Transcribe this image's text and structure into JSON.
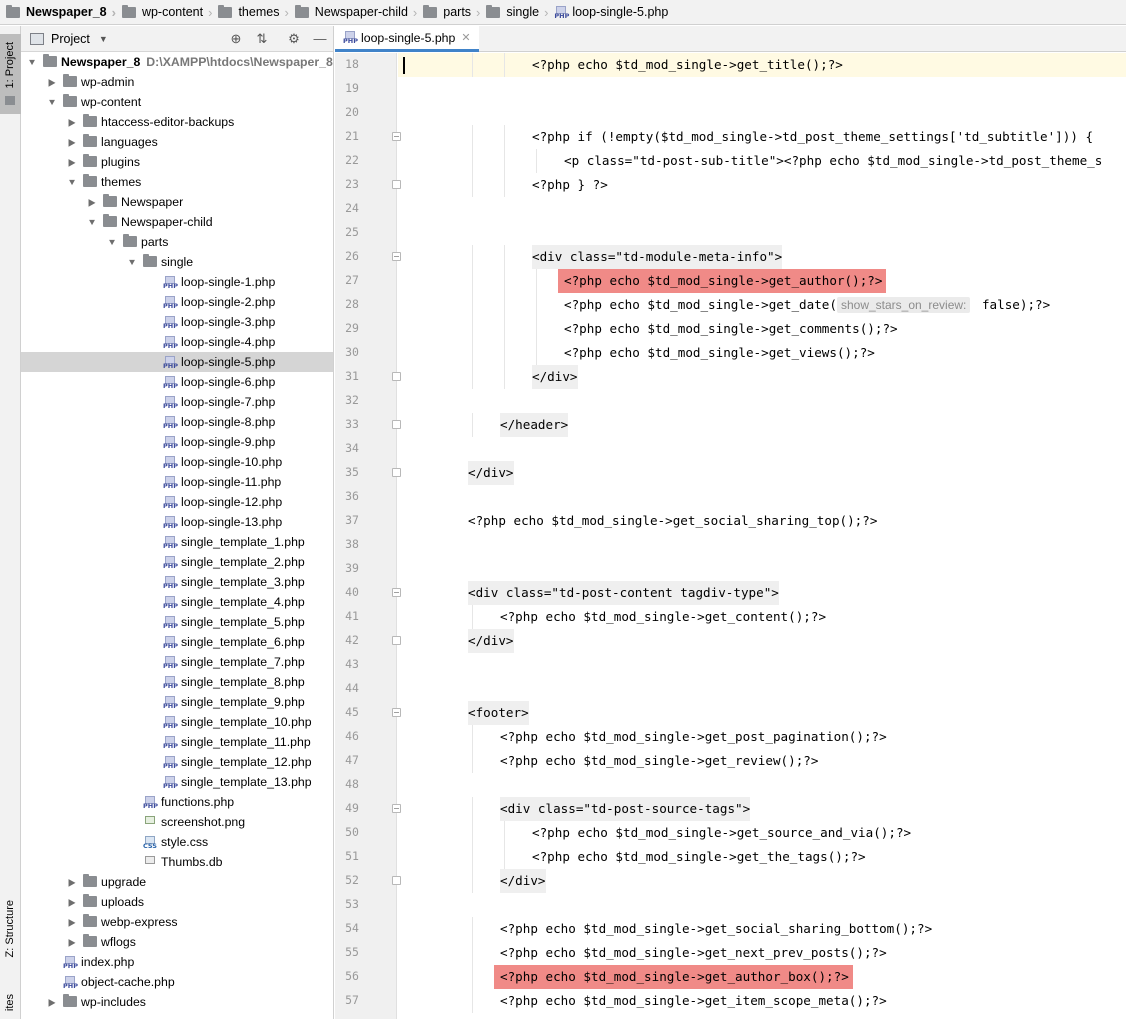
{
  "breadcrumb": [
    {
      "label": "Newspaper_8",
      "icon": "folder-icon"
    },
    {
      "label": "wp-content",
      "icon": "folder-icon"
    },
    {
      "label": "themes",
      "icon": "folder-icon"
    },
    {
      "label": "Newspaper-child",
      "icon": "folder-icon"
    },
    {
      "label": "parts",
      "icon": "folder-icon"
    },
    {
      "label": "single",
      "icon": "folder-icon"
    },
    {
      "label": "loop-single-5.php",
      "icon": "php-file-icon"
    }
  ],
  "left_strip": {
    "project_tab": "1: Project",
    "structure_tab": "Z: Structure",
    "favorites_tab": "ites"
  },
  "project_panel": {
    "title": "Project",
    "tree": [
      {
        "label": "Newspaper_8",
        "hint": "D:\\XAMPP\\htdocs\\Newspaper_8",
        "type": "folder",
        "expanded": true,
        "bold": true
      },
      {
        "label": "wp-admin",
        "type": "folder",
        "expanded": false
      },
      {
        "label": "wp-content",
        "type": "folder",
        "expanded": true
      },
      {
        "label": "htaccess-editor-backups",
        "type": "folder",
        "expanded": false
      },
      {
        "label": "languages",
        "type": "folder",
        "expanded": false
      },
      {
        "label": "plugins",
        "type": "folder",
        "expanded": false
      },
      {
        "label": "themes",
        "type": "folder",
        "expanded": true
      },
      {
        "label": "Newspaper",
        "type": "folder",
        "expanded": false
      },
      {
        "label": "Newspaper-child",
        "type": "folder",
        "expanded": true
      },
      {
        "label": "parts",
        "type": "folder",
        "expanded": true
      },
      {
        "label": "single",
        "type": "folder",
        "expanded": true
      },
      {
        "label": "loop-single-1.php",
        "type": "php"
      },
      {
        "label": "loop-single-2.php",
        "type": "php"
      },
      {
        "label": "loop-single-3.php",
        "type": "php"
      },
      {
        "label": "loop-single-4.php",
        "type": "php"
      },
      {
        "label": "loop-single-5.php",
        "type": "php",
        "selected": true
      },
      {
        "label": "loop-single-6.php",
        "type": "php"
      },
      {
        "label": "loop-single-7.php",
        "type": "php"
      },
      {
        "label": "loop-single-8.php",
        "type": "php"
      },
      {
        "label": "loop-single-9.php",
        "type": "php"
      },
      {
        "label": "loop-single-10.php",
        "type": "php"
      },
      {
        "label": "loop-single-11.php",
        "type": "php"
      },
      {
        "label": "loop-single-12.php",
        "type": "php"
      },
      {
        "label": "loop-single-13.php",
        "type": "php"
      },
      {
        "label": "single_template_1.php",
        "type": "php"
      },
      {
        "label": "single_template_2.php",
        "type": "php"
      },
      {
        "label": "single_template_3.php",
        "type": "php"
      },
      {
        "label": "single_template_4.php",
        "type": "php"
      },
      {
        "label": "single_template_5.php",
        "type": "php"
      },
      {
        "label": "single_template_6.php",
        "type": "php"
      },
      {
        "label": "single_template_7.php",
        "type": "php"
      },
      {
        "label": "single_template_8.php",
        "type": "php"
      },
      {
        "label": "single_template_9.php",
        "type": "php"
      },
      {
        "label": "single_template_10.php",
        "type": "php"
      },
      {
        "label": "single_template_11.php",
        "type": "php"
      },
      {
        "label": "single_template_12.php",
        "type": "php"
      },
      {
        "label": "single_template_13.php",
        "type": "php"
      },
      {
        "label": "functions.php",
        "type": "php"
      },
      {
        "label": "screenshot.png",
        "type": "png"
      },
      {
        "label": "style.css",
        "type": "css"
      },
      {
        "label": "Thumbs.db",
        "type": "db"
      },
      {
        "label": "upgrade",
        "type": "folder",
        "expanded": false
      },
      {
        "label": "uploads",
        "type": "folder",
        "expanded": false
      },
      {
        "label": "webp-express",
        "type": "folder",
        "expanded": false
      },
      {
        "label": "wflogs",
        "type": "folder",
        "expanded": false
      },
      {
        "label": "index.php",
        "type": "php"
      },
      {
        "label": "object-cache.php",
        "type": "php"
      },
      {
        "label": "wp-includes",
        "type": "folder",
        "expanded": false
      }
    ]
  },
  "editor": {
    "tab_label": "loop-single-5.php",
    "current_line": 18,
    "lines": [
      {
        "no": 18,
        "text": "<?php echo $td_mod_single->get_title();?>"
      },
      {
        "no": 19,
        "text": ""
      },
      {
        "no": 20,
        "text": ""
      },
      {
        "no": 21,
        "text": "<?php if (!empty($td_mod_single->td_post_theme_settings['td_subtitle'])) {"
      },
      {
        "no": 22,
        "text": "<p class=\"td-post-sub-title\"><?php echo $td_mod_single->td_post_theme_s"
      },
      {
        "no": 23,
        "text": "<?php } ?>"
      },
      {
        "no": 24,
        "text": ""
      },
      {
        "no": 25,
        "text": ""
      },
      {
        "no": 26,
        "text": "<div class=\"td-module-meta-info\">"
      },
      {
        "no": 27,
        "text": "<?php echo $td_mod_single->get_author();?>"
      },
      {
        "no": 28,
        "text_before_hint": "<?php echo $td_mod_single->get_date(",
        "hint": "show_stars_on_review:",
        "text_after_hint": " false);?>"
      },
      {
        "no": 29,
        "text": "<?php echo $td_mod_single->get_comments();?>"
      },
      {
        "no": 30,
        "text": "<?php echo $td_mod_single->get_views();?>"
      },
      {
        "no": 31,
        "text": "</div>"
      },
      {
        "no": 32,
        "text": ""
      },
      {
        "no": 33,
        "text": "</header>"
      },
      {
        "no": 34,
        "text": ""
      },
      {
        "no": 35,
        "text": "</div>"
      },
      {
        "no": 36,
        "text": ""
      },
      {
        "no": 37,
        "text": "<?php echo $td_mod_single->get_social_sharing_top();?>"
      },
      {
        "no": 38,
        "text": ""
      },
      {
        "no": 39,
        "text": ""
      },
      {
        "no": 40,
        "text": "<div class=\"td-post-content tagdiv-type\">"
      },
      {
        "no": 41,
        "text": "<?php echo $td_mod_single->get_content();?>"
      },
      {
        "no": 42,
        "text": "</div>"
      },
      {
        "no": 43,
        "text": ""
      },
      {
        "no": 44,
        "text": ""
      },
      {
        "no": 45,
        "text": "<footer>"
      },
      {
        "no": 46,
        "text": "<?php echo $td_mod_single->get_post_pagination();?>"
      },
      {
        "no": 47,
        "text": "<?php echo $td_mod_single->get_review();?>"
      },
      {
        "no": 48,
        "text": ""
      },
      {
        "no": 49,
        "text": "<div class=\"td-post-source-tags\">"
      },
      {
        "no": 50,
        "text": "<?php echo $td_mod_single->get_source_and_via();?>"
      },
      {
        "no": 51,
        "text": "<?php echo $td_mod_single->get_the_tags();?>"
      },
      {
        "no": 52,
        "text": "</div>"
      },
      {
        "no": 53,
        "text": ""
      },
      {
        "no": 54,
        "text": "<?php echo $td_mod_single->get_social_sharing_bottom();?>"
      },
      {
        "no": 55,
        "text": "<?php echo $td_mod_single->get_next_prev_posts();?>"
      },
      {
        "no": 56,
        "text": "<?php echo $td_mod_single->get_author_box();?>"
      },
      {
        "no": 57,
        "text": "<?php echo $td_mod_single->get_item_scope_meta();?>"
      }
    ]
  },
  "colors": {
    "selection_bg": "#d5d5d5",
    "current_line_bg": "#fffae3",
    "error_highlight": "#f08a87",
    "tab_underline": "#4083c9"
  }
}
